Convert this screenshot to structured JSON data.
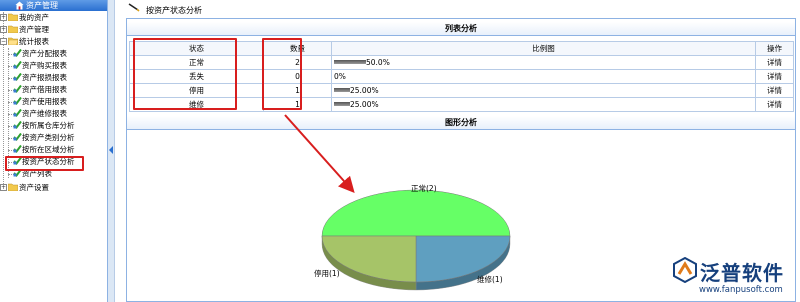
{
  "sidebar": {
    "header": "资产管理",
    "items": [
      {
        "label": "我的资产"
      },
      {
        "label": "资产管理"
      },
      {
        "label": "统计报表"
      },
      {
        "label": "资产分配报表"
      },
      {
        "label": "资产购买报表"
      },
      {
        "label": "资产报损报表"
      },
      {
        "label": "资产借用报表"
      },
      {
        "label": "资产使用报表"
      },
      {
        "label": "资产维修报表"
      },
      {
        "label": "按所属仓库分析"
      },
      {
        "label": "按资产类别分析"
      },
      {
        "label": "按所在区域分析"
      },
      {
        "label": "按资产状态分析"
      },
      {
        "label": "资产列表"
      },
      {
        "label": "资产设置"
      }
    ]
  },
  "page_title": "按资产状态分析",
  "list_section": "列表分析",
  "chart_section": "图形分析",
  "table": {
    "headers": [
      "状态",
      "数量",
      "比例图",
      "操作"
    ],
    "rows": [
      {
        "status": "正常",
        "count": "2",
        "pct": "50.0%",
        "ratio": 0.5,
        "action": "详情"
      },
      {
        "status": "丢失",
        "count": "0",
        "pct": "0%",
        "ratio": 0.0,
        "action": "详情"
      },
      {
        "status": "停用",
        "count": "1",
        "pct": "25.00%",
        "ratio": 0.25,
        "action": "详情"
      },
      {
        "status": "维修",
        "count": "1",
        "pct": "25.00%",
        "ratio": 0.25,
        "action": "详情"
      }
    ]
  },
  "chart_data": {
    "type": "pie",
    "title": "",
    "slices": [
      {
        "label": "正常(2)",
        "value": 2,
        "color": "#66ff66"
      },
      {
        "label": "维修(1)",
        "value": 1,
        "color": "#5f9fc0"
      },
      {
        "label": "停用(1)",
        "value": 1,
        "color": "#a6c468"
      }
    ]
  },
  "logo": {
    "brand": "泛普软件",
    "url": "www.fanpusoft.com"
  },
  "colors": {
    "accent": "#2a6fd0",
    "border": "#8db2e3",
    "highlight": "#d81e1e"
  }
}
